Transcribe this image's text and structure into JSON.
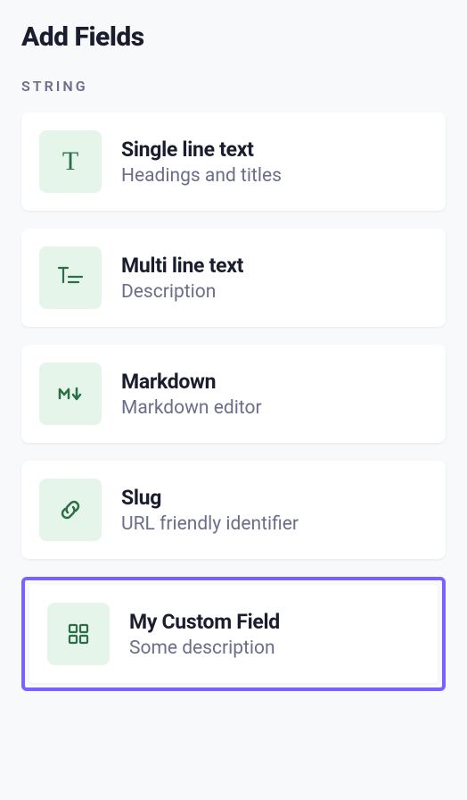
{
  "header": {
    "title": "Add Fields"
  },
  "section": {
    "label": "STRING"
  },
  "fields": [
    {
      "icon": "text-icon",
      "title": "Single line text",
      "desc": "Headings and titles",
      "highlighted": false
    },
    {
      "icon": "multiline-text-icon",
      "title": "Multi line text",
      "desc": "Description",
      "highlighted": false
    },
    {
      "icon": "markdown-icon",
      "title": "Markdown",
      "desc": "Markdown editor",
      "highlighted": false
    },
    {
      "icon": "slug-icon",
      "title": "Slug",
      "desc": "URL friendly identifier",
      "highlighted": false
    },
    {
      "icon": "custom-field-icon",
      "title": "My Custom Field",
      "desc": "Some description",
      "highlighted": true
    }
  ]
}
